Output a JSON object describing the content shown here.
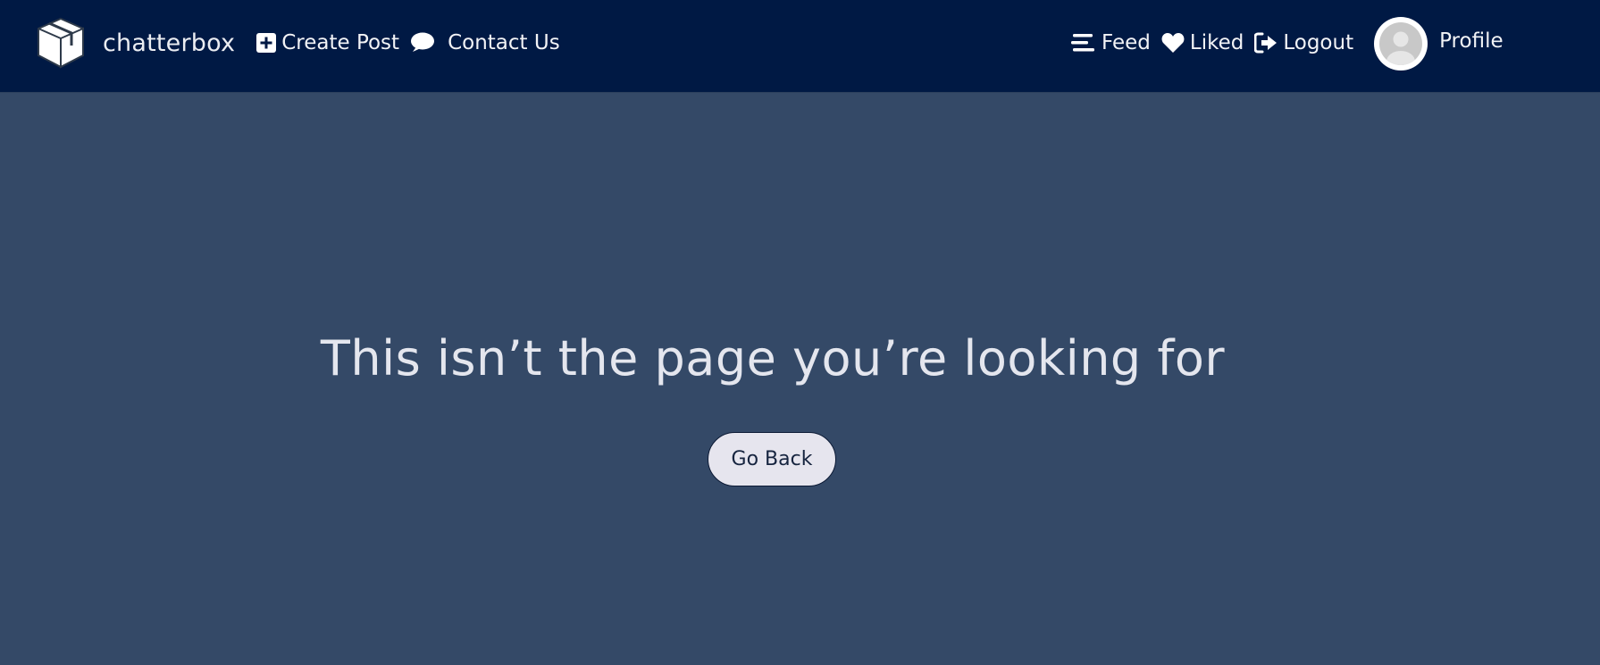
{
  "nav": {
    "brand": {
      "name": "chatterbox",
      "icon": "box-icon"
    },
    "left_links": [
      {
        "label": "Create Post",
        "icon": "plus-square-icon"
      },
      {
        "label": "Contact Us",
        "icon": "speech-bubble-icon"
      }
    ],
    "right_links": [
      {
        "label": "Feed",
        "icon": "bars-icon"
      },
      {
        "label": "Liked",
        "icon": "heart-icon"
      },
      {
        "label": "Logout",
        "icon": "sign-out-icon"
      }
    ],
    "profile": {
      "label": "Profile",
      "icon": "user-avatar-icon"
    }
  },
  "main": {
    "heading": "This isn’t the page you’re looking for",
    "back_button": "Go Back"
  },
  "colors": {
    "navbar_bg": "#001944",
    "page_bg": "#344967",
    "button_bg": "#e6e5ee",
    "text_light": "#e4e6ee"
  }
}
